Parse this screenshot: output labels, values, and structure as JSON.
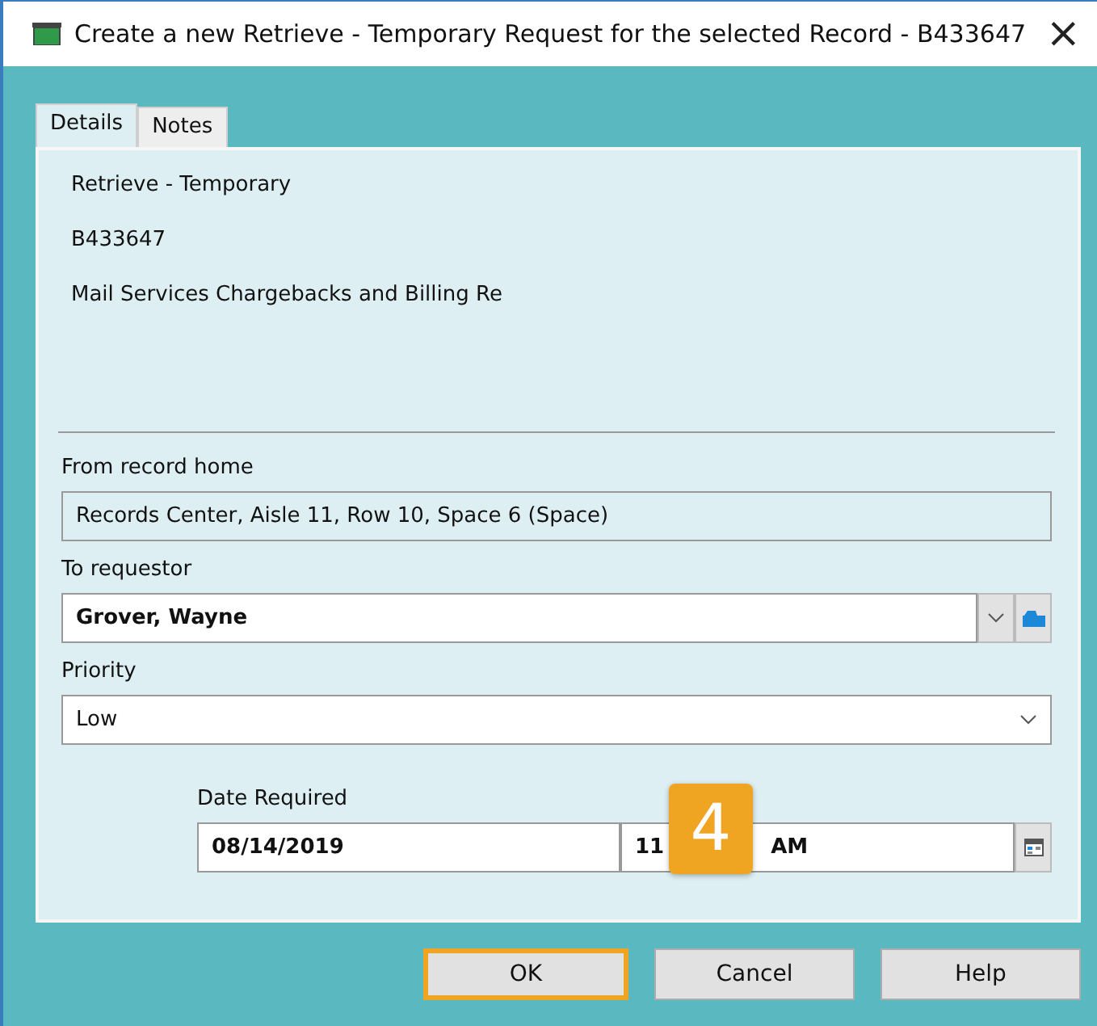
{
  "window": {
    "title": "Create a new Retrieve - Temporary Request for the selected Record - B433647",
    "close": "×"
  },
  "tabs": [
    {
      "label": "Details",
      "selected": true
    },
    {
      "label": "Notes",
      "selected": false
    }
  ],
  "summary": [
    "Retrieve - Temporary",
    "B433647",
    "Mail Services Chargebacks and Billing Re"
  ],
  "from_home": {
    "label": "From record home",
    "value": "Records Center, Aisle 11, Row 10, Space 6 (Space)"
  },
  "requestor": {
    "label": "To requestor",
    "value": "Grover, Wayne"
  },
  "priority": {
    "label": "Priority",
    "value": "Low"
  },
  "date_required": {
    "label": "Date Required",
    "date": "08/14/2019",
    "time_parts": [
      "11",
      "AM"
    ]
  },
  "step_badge": "4",
  "buttons": [
    {
      "label": "OK",
      "selected": true
    },
    {
      "label": "Cancel",
      "selected": false
    },
    {
      "label": "Help",
      "selected": false
    }
  ]
}
